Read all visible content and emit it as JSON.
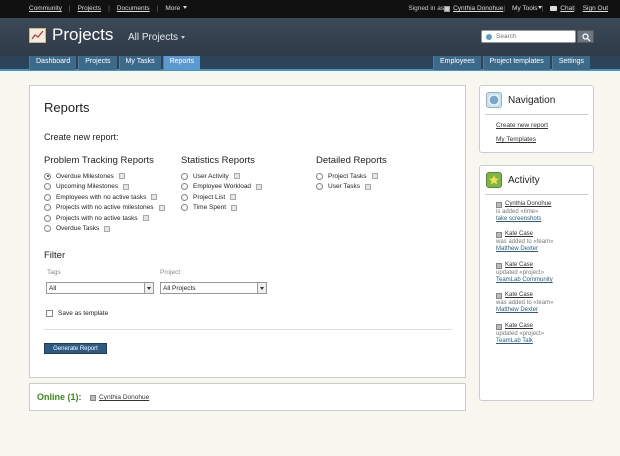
{
  "topbar": {
    "links": [
      "Community",
      "Projects",
      "Documents"
    ],
    "more_label": "More",
    "signed_in_label": "Signed in as",
    "user_name": "Cynthia Donohue",
    "tools_label": "My Tools",
    "chat_label": "Chat",
    "sign_out_label": "Sign Out"
  },
  "header": {
    "title": "Projects",
    "module": "All Projects",
    "search_placeholder": "Search"
  },
  "nav": {
    "left_tabs": [
      "Dashboard",
      "Projects",
      "My Tasks",
      "Reports"
    ],
    "active_tab": "Reports",
    "right_tabs": [
      "Employees",
      "Project templates",
      "Settings"
    ]
  },
  "main": {
    "title": "Reports",
    "create_label": "Create new report:",
    "columns": [
      {
        "heading": "Problem Tracking Reports",
        "options": [
          "Overdue Milestones",
          "Upcoming Milestones",
          "Employees with no active tasks",
          "Projects with no active milestones",
          "Projects with no active tasks",
          "Overdue Tasks"
        ]
      },
      {
        "heading": "Statistics Reports",
        "options": [
          "User Activity",
          "Employee Workload",
          "Project List",
          "Time Spent"
        ]
      },
      {
        "heading": "Detailed Reports",
        "options": [
          "Project Tasks",
          "User Tasks"
        ]
      }
    ],
    "selected_option": "Overdue Milestones",
    "filter": {
      "heading": "Filter",
      "tags_label": "Tags",
      "tags_value": "All",
      "project_label": "Project",
      "project_value": "All Projects"
    },
    "save_template_label": "Save as template",
    "generate_label": "Generate Report"
  },
  "online": {
    "label": "Online (1):",
    "users": [
      "Cynthia Donohue"
    ]
  },
  "navigation": {
    "title": "Navigation",
    "links": [
      "Create new report",
      "My Templates"
    ]
  },
  "activity": {
    "title": "Activity",
    "items": [
      {
        "user": "Cynthia Donohue",
        "action": "is added «time»",
        "object": "take screenshots"
      },
      {
        "user": "Kate Case",
        "action": "was added to «team»",
        "object": "Matthew Dexter"
      },
      {
        "user": "Kate Case",
        "action": "updated «project»",
        "object": "TeamLab Community"
      },
      {
        "user": "Kate Case",
        "action": "was added to «team»",
        "object": "Matthew Dexter"
      },
      {
        "user": "Kate Case",
        "action": "updated «project»",
        "object": "TeamLab Talk"
      }
    ]
  },
  "colors": {
    "accent": "#5a9ad0",
    "nav_bar": "#2c4459",
    "header": "#3c4957",
    "online_green": "#3a8a1a",
    "button": "#2d5a82"
  }
}
